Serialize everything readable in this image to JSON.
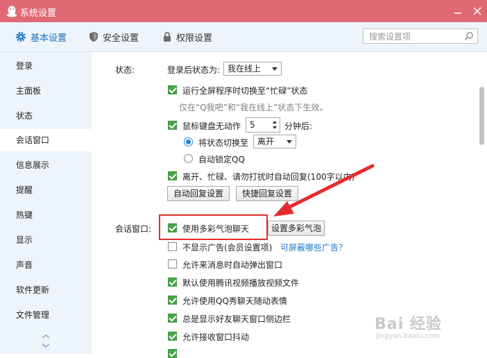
{
  "window": {
    "title": "系统设置",
    "accent_color": "#e06a74",
    "logo_icon": "qq-penguin-icon",
    "buttons": [
      "minimize-icon",
      "close-icon"
    ]
  },
  "toolbar": {
    "tabs": [
      {
        "label": "基本设置",
        "icon": "gear-icon",
        "active": true
      },
      {
        "label": "安全设置",
        "icon": "shield-icon",
        "active": false
      },
      {
        "label": "权限设置",
        "icon": "lock-icon",
        "active": false
      }
    ],
    "search": {
      "placeholder": "搜索设置项",
      "value": "",
      "icon": "search-icon"
    }
  },
  "sidebar": {
    "items": [
      {
        "label": "登录"
      },
      {
        "label": "主面板"
      },
      {
        "label": "状态"
      },
      {
        "label": "会话窗口",
        "selected": true
      },
      {
        "label": "信息展示"
      },
      {
        "label": "提醒"
      },
      {
        "label": "热键"
      },
      {
        "label": "显示"
      },
      {
        "label": "声音"
      },
      {
        "label": "软件更新"
      },
      {
        "label": "文件管理"
      }
    ],
    "scroll_icons": [
      "chevron-up-icon",
      "chevron-down-icon"
    ]
  },
  "status": {
    "section_label": "状态:",
    "after_login_label": "登录后状态为:",
    "after_login_value": "我在线上",
    "fullscreen_busy": {
      "label": "运行全屏程序时切换至“忙碌”状态",
      "checked": true
    },
    "fullscreen_note": "仅在“Q我吧”和“我在线上”状态下生效。",
    "idle": {
      "label": "鼠标键盘无动作",
      "checked": true,
      "minutes": "5",
      "suffix": "分钟后:"
    },
    "switch_to": {
      "label": "将状态切换至",
      "selected": true,
      "value": "离开"
    },
    "lock_qq": {
      "label": "自动锁定QQ",
      "selected": false
    },
    "auto_reply": {
      "label": "离开、忙碌、请勿打扰时自动回复(100字以内)",
      "checked": true
    },
    "auto_reply_button": "自动回复设置",
    "quick_reply_button": "快捷回复设置"
  },
  "chat_window": {
    "section_label": "会话窗口:",
    "bubble": {
      "label": "使用多彩气泡聊天",
      "checked": true
    },
    "bubble_button": "设置多彩气泡",
    "no_ads": {
      "label": "不显示广告(会员设置项)",
      "checked": false
    },
    "ads_link": "可屏蔽哪些广告？",
    "auto_popup": {
      "label": "允许来消息时自动弹出窗口",
      "checked": false
    },
    "tencent_video": {
      "label": "默认使用腾讯视频播放视频文件",
      "checked": true
    },
    "qq_show": {
      "label": "允许使用QQ秀聊天随动表情",
      "checked": true
    },
    "sidebar": {
      "label": "总是显示好友聊天窗口侧边栏",
      "checked": true
    },
    "shake": {
      "label": "允许接收窗口抖动",
      "checked": true
    }
  },
  "annotation": {
    "highlight_color": "#e22c2c",
    "arrow_color": "#e22c2c"
  },
  "watermark": {
    "brand": "Bai 经验",
    "url": "jingyan.baidu.com"
  }
}
